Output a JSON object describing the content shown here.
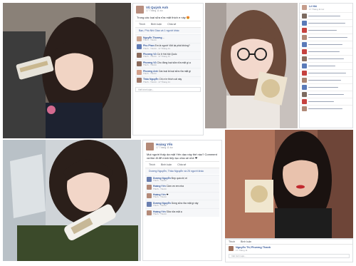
{
  "colors": {
    "fb_blue": "#365899",
    "meta_gray": "#90949c",
    "panel_border": "#dddfe2"
  },
  "post_top": {
    "author": "Vũ Quỳnh Anh",
    "date": "17 Tháng 11 lúc",
    "text": "Trong các loại sữa rửa mặt thích e này 😍",
    "actions": [
      "Thích",
      "Bình luận",
      "Chia sẻ"
    ],
    "likes": "Bạn, Phú Nhi Giao và 1 người khác",
    "comments": [
      {
        "name": "Nguyễn Thương",
        "text": "...",
        "meta": "Thích · Trả lời"
      },
      {
        "name": "Phu Phan",
        "text": "Em là người Việt lại phải không?",
        "meta": "Thích · Trả lời · 17 Tháng 11"
      },
      {
        "name": "Phương Vũ",
        "text": "Có ở Hà Nội Quốc",
        "meta": "Thích · Trả lời · 17 Tháng 11"
      },
      {
        "name": "Phương Vũ",
        "text": "Cho đồng loại sữa rửa mặt gì ạ",
        "meta": "Thích · Trả lời"
      },
      {
        "name": "Phương Anh",
        "text": "Các loại là loại sữa rửa mặt gì",
        "meta": "Thích · Trả lời"
      },
      {
        "name": "Thảo Nguyễn",
        "text": "Chị ơi e thích cái này",
        "meta": "Thích · Trả lời · 17 Tháng 11"
      }
    ],
    "input_placeholder": "Viết bình luận..."
  },
  "post_bottom": {
    "author": "Hoàng Yến",
    "date": "17 Tháng 11 lúc",
    "text": "Mọi người thấy da mặt Yến dạo này thế nào? Comment và like đi để mình tiếp tục chia sẻ nhé ❤",
    "actions": [
      "Thích",
      "Bình luận",
      "Chia sẻ"
    ],
    "likes": "Dương Nguyễn, Thảo Nguyễn và 25 người khác",
    "comments": [
      {
        "name": "Dương Nguyễn",
        "text": "Đẹp quá chị ơi",
        "meta": "Thích · Trả lời"
      },
      {
        "name": "Hoàng Yến",
        "text": "Cảm ơn em nha",
        "meta": "Thích · Trả lời"
      },
      {
        "name": "Hoàng Yến",
        "text": "❤",
        "meta": "Thích · Trả lời"
      },
      {
        "name": "Dương Nguyễn",
        "text": "Dùng sữa rửa mặt gì vậy",
        "meta": "Thích · Trả lời"
      },
      {
        "name": "Hoàng Yến",
        "text": "Sữa rửa mặt ạ",
        "meta": "Thích · Trả lời"
      }
    ]
  },
  "post_bottom_right": {
    "author": "Nguyễn Thị Phương Thanh",
    "date": "17 Tháng 11",
    "input_placeholder": "Viết bình luận...",
    "actions": [
      "Thích",
      "Bình luận"
    ]
  },
  "post_right_top": {
    "author": "Lê Nhi",
    "date": "17 Tháng 11 lúc"
  }
}
